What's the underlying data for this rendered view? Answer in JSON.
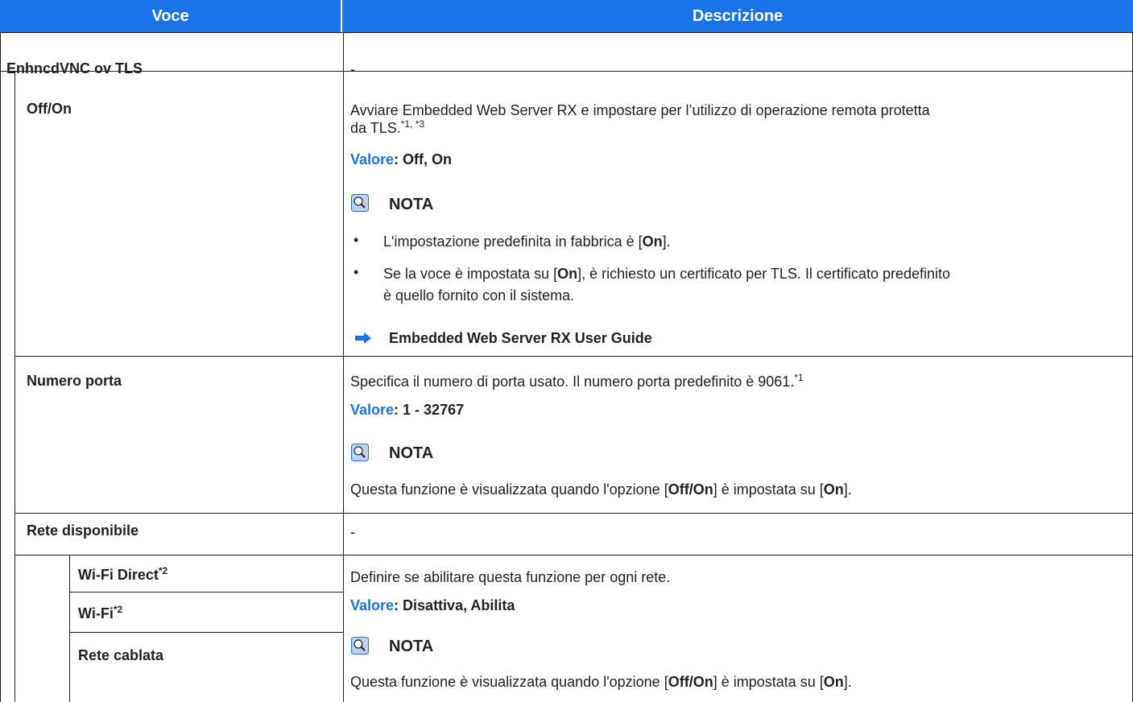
{
  "header": {
    "col1": "Voce",
    "col2": "Descrizione"
  },
  "rows": {
    "enh": {
      "label": "EnhncdVNC ov TLS",
      "desc": "-"
    },
    "offon": {
      "label": "Off/On",
      "desc_line1": "Avviare Embedded Web Server RX e impostare per l’utilizzo di operazione remota protetta",
      "desc_line2": "da TLS.",
      "desc_sup": "*1, *3",
      "value_label": "Valore",
      "value_text": ": Off, On",
      "note_title": "NOTA",
      "bullet1_pre": "L'impostazione predefinita in fabbrica è [",
      "bullet1_bold": "On",
      "bullet1_post": "].",
      "bullet2_pre": "Se la voce è impostata su [",
      "bullet2_bold": "On",
      "bullet2_post": "], è richiesto un certificato per TLS. Il certificato predefinito",
      "bullet2_line2": "è quello fornito con il sistema.",
      "link": "Embedded Web Server RX User Guide"
    },
    "porta": {
      "label": "Numero porta",
      "desc": "Specifica il numero di porta usato. Il numero porta predefinito è 9061.",
      "desc_sup": "*1",
      "value_label": "Valore",
      "value_text": ": 1 - 32767",
      "note_title": "NOTA",
      "note_pre": "Questa funzione è visualizzata quando l'opzione [",
      "note_b1": "Off/On",
      "note_mid": "] è impostata su [",
      "note_b2": "On",
      "note_post": "]."
    },
    "rete": {
      "label": "Rete disponibile",
      "desc": "-"
    },
    "wifidirect": {
      "label": "Wi-Fi Direct",
      "sup": "*2"
    },
    "wifi": {
      "label": "Wi-Fi",
      "sup": "*2"
    },
    "cablata": {
      "label": "Rete cablata"
    },
    "netdesc": {
      "desc": "Definire se abilitare questa funzione per ogni rete.",
      "value_label": "Valore",
      "value_text": ": Disattiva, Abilita",
      "note_title": "NOTA",
      "note_pre": "Questa funzione è visualizzata quando l'opzione [",
      "note_b1": "Off/On",
      "note_mid": "] è impostata su [",
      "note_b2": "On",
      "note_post": "]."
    }
  },
  "colors": {
    "accent": "#1a73e8",
    "text": "#231f20"
  },
  "icons": {
    "note": "lightbulb-note-icon",
    "link": "arrow-right-icon",
    "bullet": "bullet-dot"
  }
}
